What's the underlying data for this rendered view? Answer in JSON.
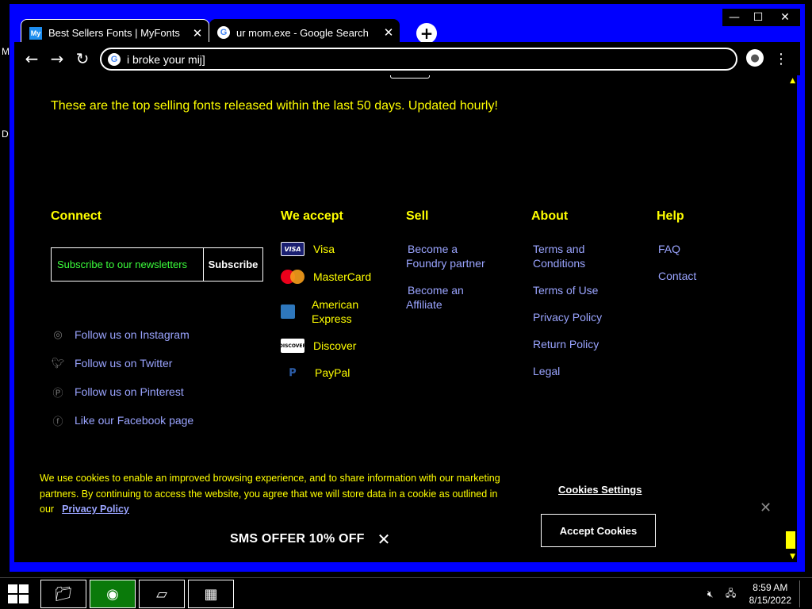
{
  "desktop": {
    "glyph_1": "M",
    "glyph_2": "D"
  },
  "window_controls": {
    "minimize": "—",
    "maximize": "☐",
    "close": "✕"
  },
  "tabs": [
    {
      "title": "Best Sellers Fonts | MyFonts",
      "favicon": "My",
      "close": "✕"
    },
    {
      "title": "ur mom.exe - Google Search",
      "favicon": "G",
      "close": "✕"
    }
  ],
  "new_tab": "+",
  "toolbar": {
    "back": "←",
    "forward": "→",
    "reload": "↻",
    "address": "i broke your mij]",
    "menu": "⋮"
  },
  "page": {
    "headline": "These are the top selling fonts released within the last 50 days. Updated hourly!",
    "connect": {
      "heading": "Connect",
      "subscribe_placeholder": "Subscribe to our newsletters",
      "subscribe_button": "Subscribe",
      "social": [
        {
          "icon": "instagram-icon",
          "label": "Follow us on Instagram"
        },
        {
          "icon": "twitter-icon",
          "label": "Follow us on Twitter"
        },
        {
          "icon": "pinterest-icon",
          "label": "Follow us on Pinterest"
        },
        {
          "icon": "facebook-icon",
          "label": "Like our Facebook page"
        }
      ]
    },
    "we_accept": {
      "heading": "We accept",
      "methods": [
        {
          "icon": "visa-icon",
          "label": "Visa",
          "card_text": "VISA"
        },
        {
          "icon": "mastercard-icon",
          "label": "MasterCard",
          "card_text": ""
        },
        {
          "icon": "amex-icon",
          "label": "American Express",
          "card_text": ""
        },
        {
          "icon": "discover-icon",
          "label": "Discover",
          "card_text": "DISCOVER"
        },
        {
          "icon": "paypal-icon",
          "label": "PayPal",
          "card_text": ""
        }
      ]
    },
    "sell": {
      "heading": "Sell",
      "links": [
        "Become a Foundry partner",
        "Become an Affiliate"
      ]
    },
    "about": {
      "heading": "About",
      "links": [
        "Terms and Conditions",
        "Terms of Use",
        "Privacy Policy",
        "Return Policy",
        "Legal"
      ]
    },
    "help": {
      "heading": "Help",
      "links": [
        "FAQ",
        "Contact"
      ]
    }
  },
  "cookie_banner": {
    "text": "We use cookies to enable an improved browsing experience, and to share information with our marketing partners. By continuing to access the website, you agree that we will store data in a cookie as outlined in our",
    "privacy_link": "Privacy Policy",
    "settings": "Cookies Settings",
    "accept": "Accept Cookies",
    "close": "✕"
  },
  "sms_offer": {
    "label": "SMS OFFER 10% OFF",
    "close": "✕"
  },
  "taskbar": {
    "time": "8:59 AM",
    "date": "8/15/2022"
  },
  "colors": {
    "window_frame": "#0000ff",
    "high_contrast_text": "#ffff00",
    "link": "#9aa4ff",
    "placeholder": "#3cff3c"
  }
}
